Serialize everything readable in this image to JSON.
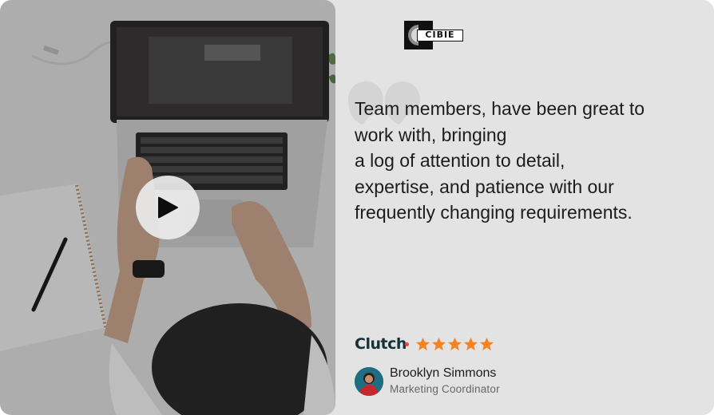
{
  "video": {
    "play_icon": "play-icon",
    "overlay_color": "#000000"
  },
  "company": {
    "logo_text": "CIBIE"
  },
  "testimonial": {
    "quote_icon": "quote-icon",
    "lines": [
      "Team members, have been great to",
      "work with, bringing",
      "a log of attention to detail,",
      "expertise, and patience with our",
      "frequently changing requirements."
    ]
  },
  "rating": {
    "platform": "Clutch",
    "stars": 5,
    "star_color": "#f5821f"
  },
  "reviewer": {
    "name": "Brooklyn Simmons",
    "role": "Marketing Coordinator"
  }
}
